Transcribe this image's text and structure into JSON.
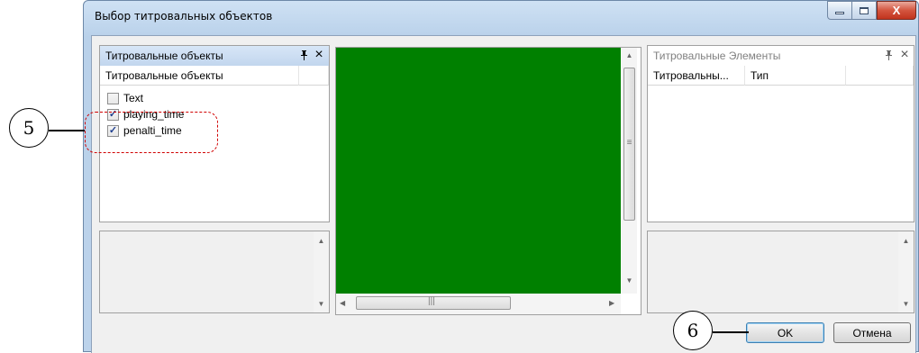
{
  "window": {
    "title": "Выбор титровальных объектов"
  },
  "left_panel": {
    "title": "Титровальные объекты",
    "pin_icon": "ᵽ",
    "close_icon": "×",
    "column_header": "Титровальные объекты",
    "items": [
      {
        "label": "Text",
        "checked": false
      },
      {
        "label": "playing_time",
        "checked": true
      },
      {
        "label": "penalti_time",
        "checked": true
      }
    ]
  },
  "preview": {
    "background_color": "#008000"
  },
  "right_panel": {
    "title": "Титровальные Элементы",
    "columns": [
      "Титровальны...",
      "Тип"
    ]
  },
  "buttons": {
    "ok": "OK",
    "cancel": "Отмена"
  },
  "callouts": {
    "left": "5",
    "bottom": "6"
  }
}
